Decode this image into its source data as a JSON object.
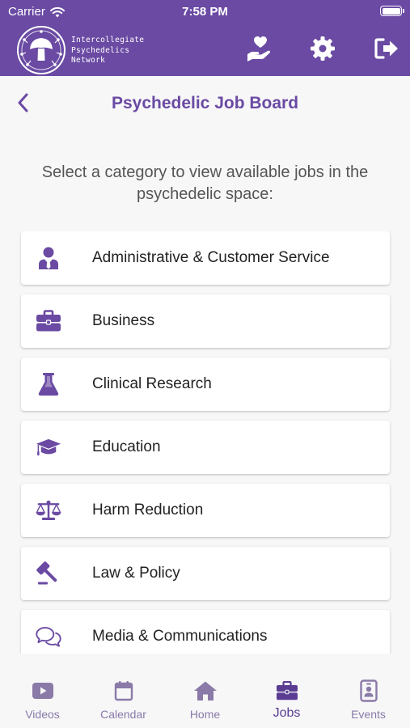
{
  "status": {
    "carrier": "Carrier",
    "time": "7:58 PM"
  },
  "header": {
    "org_line1": "Intercollegiate",
    "org_line2": "Psychedelics",
    "org_line3": "Network"
  },
  "page": {
    "title": "Psychedelic Job Board",
    "intro": "Select a category to view available jobs in the psychedelic space:"
  },
  "categories": [
    {
      "label": "Administrative & Customer Service",
      "icon": "user-tie-icon"
    },
    {
      "label": "Business",
      "icon": "briefcase-icon"
    },
    {
      "label": "Clinical Research",
      "icon": "flask-icon"
    },
    {
      "label": "Education",
      "icon": "graduation-cap-icon"
    },
    {
      "label": "Harm Reduction",
      "icon": "balance-scale-icon"
    },
    {
      "label": "Law & Policy",
      "icon": "gavel-icon"
    },
    {
      "label": "Media & Communications",
      "icon": "comments-icon"
    }
  ],
  "tabs": [
    {
      "label": "Videos",
      "icon": "video-icon"
    },
    {
      "label": "Calendar",
      "icon": "calendar-icon"
    },
    {
      "label": "Home",
      "icon": "home-icon"
    },
    {
      "label": "Jobs",
      "icon": "briefcase-icon",
      "active": true
    },
    {
      "label": "Events",
      "icon": "id-badge-icon"
    }
  ],
  "colors": {
    "brand": "#6a4aa3",
    "tab_inactive": "#8a7aa8",
    "tab_active": "#5a3d93"
  }
}
